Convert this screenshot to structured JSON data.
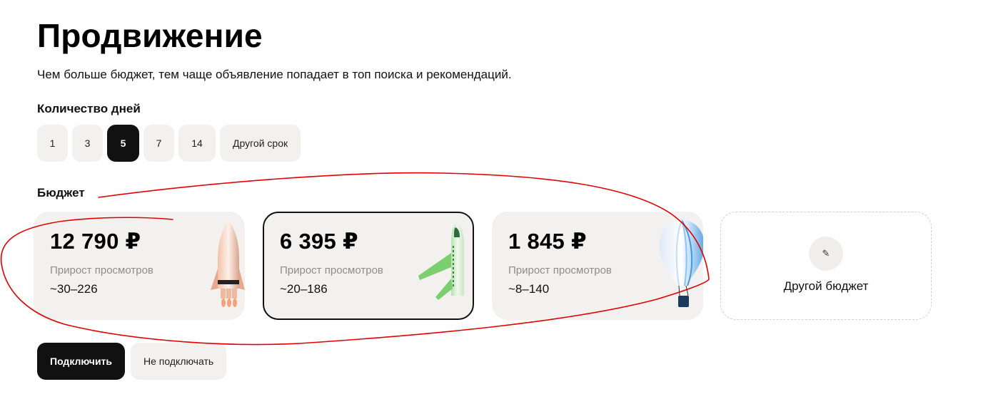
{
  "page": {
    "title": "Продвижение",
    "subtitle": "Чем больше бюджет, тем чаще объявление попадает в топ поиска и рекомендаций."
  },
  "days": {
    "label": "Количество дней",
    "options": [
      "1",
      "3",
      "5",
      "7",
      "14",
      "Другой срок"
    ],
    "selected": "5"
  },
  "budget": {
    "label": "Бюджет",
    "cards": [
      {
        "price": "12 790 ₽",
        "metric_label": "Прирост просмотров",
        "metric_value": "~30–226",
        "icon": "rocket-icon"
      },
      {
        "price": "6 395 ₽",
        "metric_label": "Прирост просмотров",
        "metric_value": "~20–186",
        "icon": "airplane-icon",
        "selected": true
      },
      {
        "price": "1 845 ₽",
        "metric_label": "Прирост просмотров",
        "metric_value": "~8–140",
        "icon": "hot-air-balloon-icon"
      }
    ],
    "custom": {
      "label": "Другой бюджет",
      "icon": "pencil-icon"
    }
  },
  "actions": {
    "connect": "Подключить",
    "skip": "Не подключать"
  },
  "colors": {
    "selected": "#111111",
    "chip_bg": "#f2f1ef",
    "annotation": "#e00000"
  }
}
